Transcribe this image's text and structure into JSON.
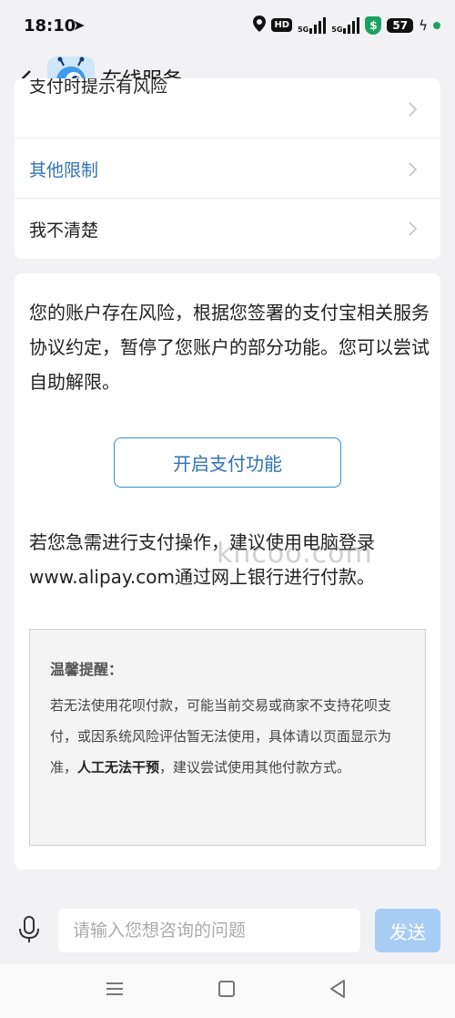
{
  "status_bar": {
    "time": "18:10",
    "hd": "HD",
    "net1": "5G",
    "net2": "5G",
    "battery": "57"
  },
  "header": {
    "title": "在线服务"
  },
  "options": [
    {
      "label": "支付时提示有风险"
    },
    {
      "label": "其他限制"
    },
    {
      "label": "我不清楚"
    }
  ],
  "message": {
    "text": "您的账户存在风险，根据您签署的支付宝相关服务协议约定，暂停了您账户的部分功能。您可以尝试自助解限。",
    "button_label": "开启支付功能",
    "urgent_text": "若您急需进行支付操作，建议使用电脑登录www.alipay.com通过网上银行进行付款。"
  },
  "tip": {
    "title": "温馨提醒：",
    "body_before": "若无法使用花呗付款，可能当前交易或商家不支持花呗支付，或因系统风险评估暂无法使用，具体请以页面显示为准，",
    "body_bold": "人工无法干预",
    "body_after": "，建议尝试使用其他付款方式。"
  },
  "watermark": "khcoo.com",
  "input": {
    "placeholder": "请输入您想咨询的问题",
    "send_label": "发送"
  },
  "colors": {
    "accent": "#2f73b7",
    "send_disabled": "#a8cdf5",
    "background": "#f2f2f4"
  }
}
